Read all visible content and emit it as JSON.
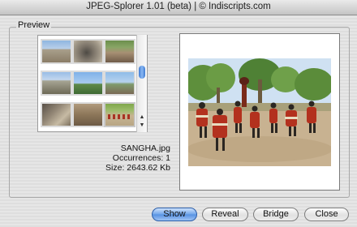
{
  "window": {
    "title": "JPEG-Splorer 1.01 (beta)  |  © Indiscripts.com"
  },
  "preview": {
    "group_label": "Preview",
    "filename": "SANGHA.jpg",
    "occurrences": "Occurrences: 1",
    "size": "Size: 2643.62 Kb"
  },
  "buttons": {
    "show": "Show",
    "reveal": "Reveal",
    "bridge": "Bridge",
    "close": "Close"
  },
  "icons": {
    "scroll_up": "scroll-up-arrow",
    "scroll_down": "scroll-down-arrow"
  },
  "colors": {
    "accent": "#5691e2",
    "window_bg": "#e2e2e2"
  }
}
